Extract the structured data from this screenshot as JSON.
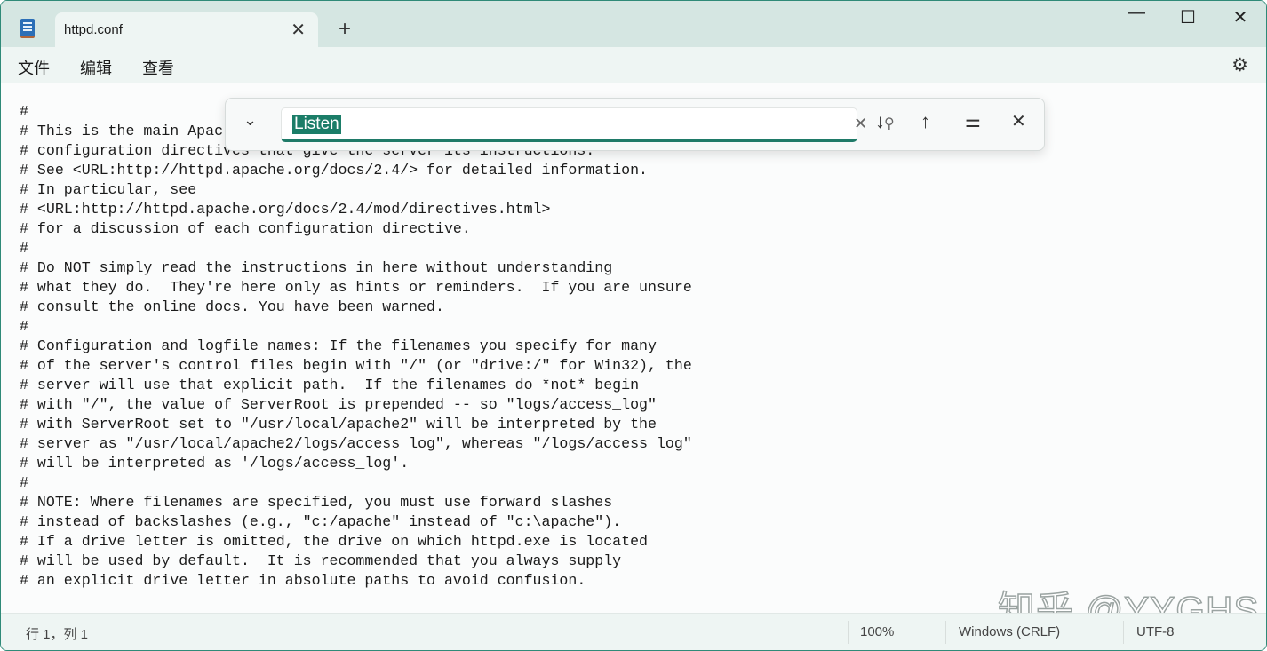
{
  "window": {
    "tab_title": "httpd.conf",
    "icons": {
      "app": "notepad-icon",
      "close_tab": "close-icon",
      "new_tab": "plus-icon",
      "minimize": "minimize-icon",
      "maximize": "maximize-icon",
      "close": "close-icon",
      "settings": "gear-icon"
    }
  },
  "menu": [
    {
      "label": "文件"
    },
    {
      "label": "编辑"
    },
    {
      "label": "查看"
    }
  ],
  "find": {
    "query": "Listen",
    "icons": [
      "chevron-down-icon",
      "clear-icon",
      "search-icon",
      "arrow-down-icon",
      "arrow-up-icon",
      "options-icon",
      "close-icon"
    ]
  },
  "editor": {
    "lines": [
      "#",
      "# This is the main Apac",
      "# configuration directives that give the server its instructions.",
      "# See <URL:http://httpd.apache.org/docs/2.4/> for detailed information.",
      "# In particular, see",
      "# <URL:http://httpd.apache.org/docs/2.4/mod/directives.html>",
      "# for a discussion of each configuration directive.",
      "#",
      "# Do NOT simply read the instructions in here without understanding",
      "# what they do.  They're here only as hints or reminders.  If you are unsure",
      "# consult the online docs. You have been warned.",
      "#",
      "# Configuration and logfile names: If the filenames you specify for many",
      "# of the server's control files begin with \"/\" (or \"drive:/\" for Win32), the",
      "# server will use that explicit path.  If the filenames do *not* begin",
      "# with \"/\", the value of ServerRoot is prepended -- so \"logs/access_log\"",
      "# with ServerRoot set to \"/usr/local/apache2\" will be interpreted by the",
      "# server as \"/usr/local/apache2/logs/access_log\", whereas \"/logs/access_log\"",
      "# will be interpreted as '/logs/access_log'.",
      "#",
      "# NOTE: Where filenames are specified, you must use forward slashes",
      "# instead of backslashes (e.g., \"c:/apache\" instead of \"c:\\apache\").",
      "# If a drive letter is omitted, the drive on which httpd.exe is located",
      "# will be used by default.  It is recommended that you always supply",
      "# an explicit drive letter in absolute paths to avoid confusion.",
      "",
      "#"
    ]
  },
  "status": {
    "position": "行 1，列 1",
    "zoom": "100%",
    "line_ending": "Windows (CRLF)",
    "encoding": "UTF-8"
  },
  "watermark": "知乎 @YYGHS",
  "colors": {
    "accent": "#1b7d68",
    "titlebar": "#d5e6e2"
  }
}
